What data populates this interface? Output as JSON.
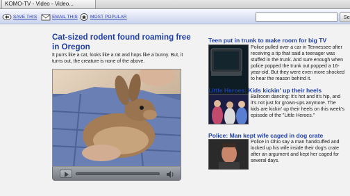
{
  "browser": {
    "tab_title": "KOMO-TV - Video - Video..."
  },
  "toolbar": {
    "save_label": "SAVE THIS",
    "email_label": "EMAIL THIS",
    "popular_label": "MOST POPULAR",
    "search_placeholder": "",
    "search_button_label": "Search"
  },
  "main_story": {
    "title": "Cat-sized rodent found roaming free in Oregon",
    "summary": "It purrs like a cat, looks like a rat and hops like a bunny. But, it turns out, the creature is none of the above."
  },
  "sidebar": {
    "stories": [
      {
        "title": "Teen put in trunk to make room for big TV",
        "body": "Police pulled over a car in Tennessee after receiving a tip that said a teenager was stuffed in the trunk. And sure enough when police popped the trunk out popped a 16-year-old. But they were even more shocked to hear the reason behind it."
      },
      {
        "title": "Little Heroes: Kids kickin' up their heels",
        "body": "Ballroom dancing: It's hot and it's hip, and it's not just for grown-ups anymore. The kids are kickin' up their heels on this week's episode of the \"Little Heroes.\""
      },
      {
        "title": "Police: Man kept wife caged in dog crate",
        "body": "Police in Ohio say a man handcuffed and locked up his wife inside their dog's crate after an argument and kept her caged for several days."
      }
    ]
  },
  "icons": {
    "save": "save-icon",
    "email": "email-icon",
    "popular": "popular-icon",
    "play": "play-icon",
    "volume": "volume-icon"
  },
  "colors": {
    "link": "#1f3ea3",
    "toolbar_link": "#2a3aa8"
  }
}
